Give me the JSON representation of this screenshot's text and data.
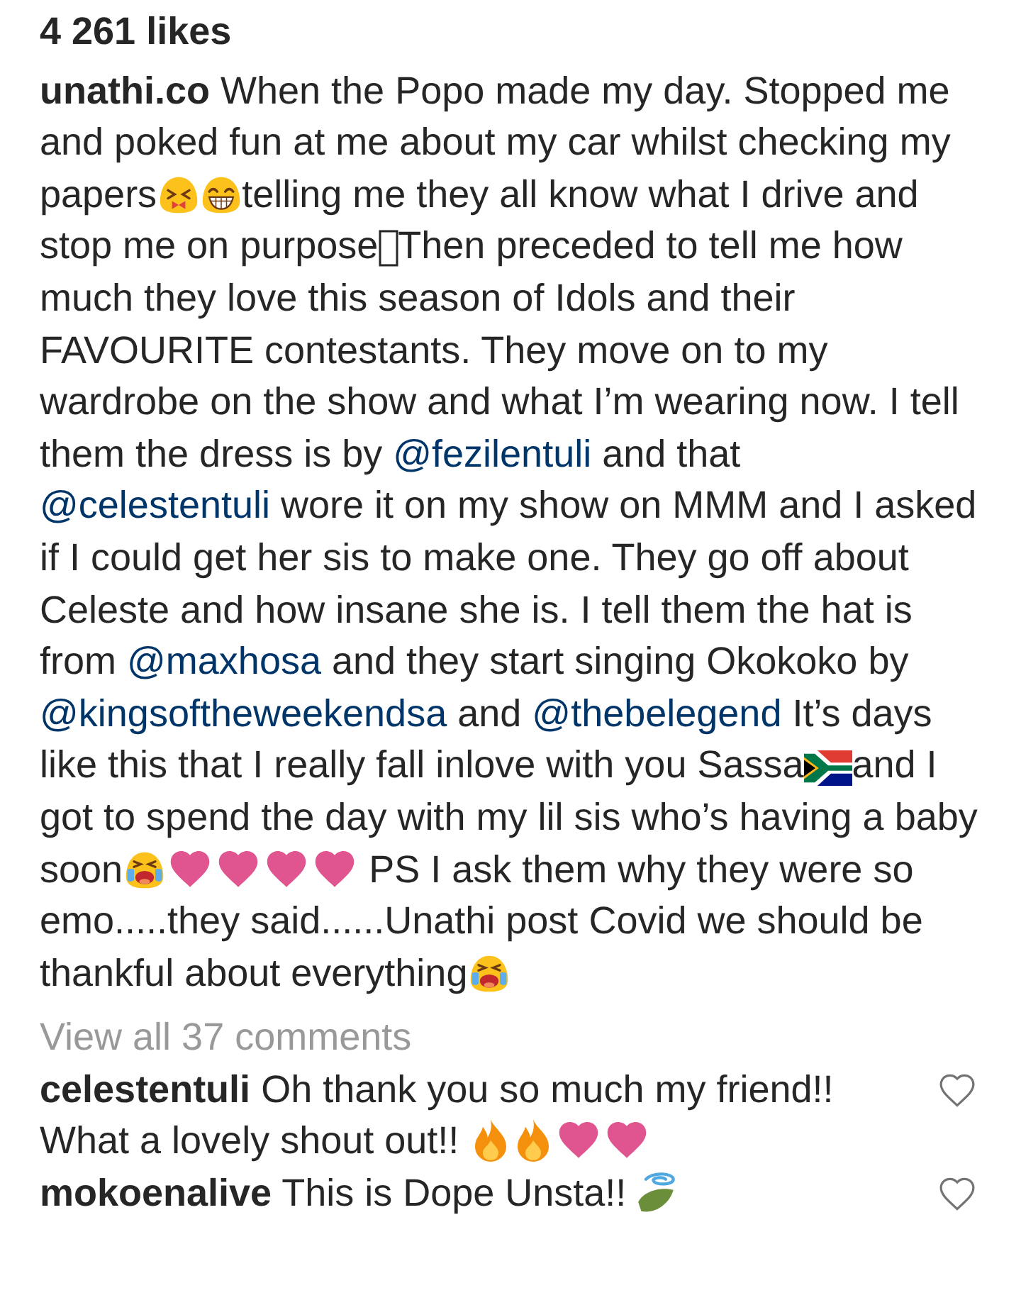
{
  "likes": "4 261 likes",
  "caption": {
    "username": "unathi.co",
    "segments": [
      {
        "kind": "text",
        "text": " When the Popo made my day. Stopped me and poked fun at me about my car whilst checking my papers"
      },
      {
        "kind": "wincing"
      },
      {
        "kind": "grin"
      },
      {
        "kind": "text",
        "text": "telling me they all know what I drive and stop me on purpose"
      },
      {
        "kind": "missing"
      },
      {
        "kind": "text",
        "text": "Then preceded to tell me how much they love this season of Idols and their FAVOURITE contestants. They move on to my wardrobe on the show and what I’m wearing now. I tell them the dress is by "
      },
      {
        "kind": "mention",
        "text": "@fezilentuli"
      },
      {
        "kind": "text",
        "text": " and that "
      },
      {
        "kind": "mention",
        "text": "@celestentuli"
      },
      {
        "kind": "text",
        "text": " wore it on my show on MMM and I asked if I could get her sis to make one. They go off about Celeste and how insane she is. I tell them the hat is from "
      },
      {
        "kind": "mention",
        "text": "@maxhosa"
      },
      {
        "kind": "text",
        "text": " and they start singing Okokoko by "
      },
      {
        "kind": "mention",
        "text": "@kingsoftheweekendsa"
      },
      {
        "kind": "text",
        "text": " and "
      },
      {
        "kind": "mention",
        "text": "@thebelegend"
      },
      {
        "kind": "text",
        "text": " It’s days like this that I really fall inlove with you Sassa"
      },
      {
        "kind": "flag"
      },
      {
        "kind": "text",
        "text": "and I got to spend the day with my lil sis who’s having a baby soon"
      },
      {
        "kind": "crying"
      },
      {
        "kind": "heart"
      },
      {
        "kind": "heart"
      },
      {
        "kind": "heart"
      },
      {
        "kind": "heart"
      },
      {
        "kind": "text",
        "text": " PS I ask them why they were so emo.....they said......Unathi post Covid we should be thankful about everything"
      },
      {
        "kind": "crying"
      }
    ]
  },
  "view_comments": "View all 37 comments",
  "comments": [
    {
      "username": "celestentuli",
      "segments": [
        {
          "kind": "text",
          "text": " Oh thank you so much my friend!! What a lovely shout out!! "
        },
        {
          "kind": "fire"
        },
        {
          "kind": "fire"
        },
        {
          "kind": "heart"
        },
        {
          "kind": "heart"
        }
      ],
      "liked": false
    },
    {
      "username": "mokoenalive",
      "segments": [
        {
          "kind": "text",
          "text": " This is Dope Unsta!! "
        },
        {
          "kind": "leaf"
        }
      ],
      "liked": false
    }
  ]
}
